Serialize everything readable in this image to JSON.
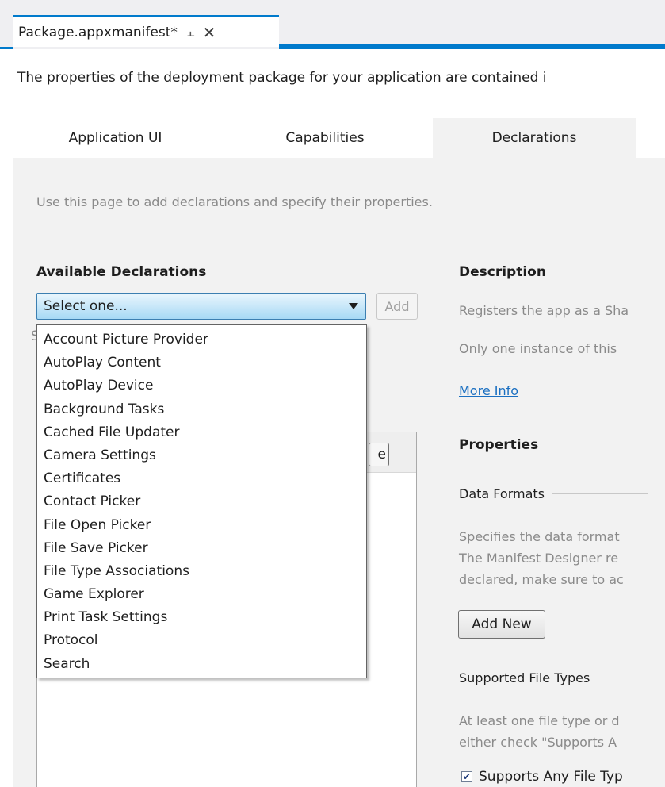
{
  "document_tab": {
    "title": "Package.appxmanifest*",
    "pin_glyph": "⌂",
    "close_glyph": "✕"
  },
  "intro": "The properties of the deployment package for your application are contained i",
  "section_tabs": [
    {
      "label": "Application UI",
      "active": false
    },
    {
      "label": "Capabilities",
      "active": false
    },
    {
      "label": "Declarations",
      "active": true
    }
  ],
  "page": {
    "hint": "Use this page to add declarations and specify their properties.",
    "available_heading": "Available Declarations",
    "select_value": "Select one...",
    "add_label": "Add",
    "stray_char": "S",
    "hidden_button_label": "e",
    "dropdown_options": [
      "Account Picture Provider",
      "AutoPlay Content",
      "AutoPlay Device",
      "Background Tasks",
      "Cached File Updater",
      "Camera Settings",
      "Certificates",
      "Contact Picker",
      "File Open Picker",
      "File Save Picker",
      "File Type Associations",
      "Game Explorer",
      "Print Task Settings",
      "Protocol",
      "Search"
    ]
  },
  "details": {
    "description_heading": "Description",
    "description_line1": "Registers the app as a Sha",
    "description_line2": "Only one instance of this",
    "more_info": "More Info",
    "properties_heading": "Properties",
    "data_formats_label": "Data Formats",
    "data_formats_text": [
      "Specifies the data format",
      "The Manifest Designer re",
      "declared, make sure to ac"
    ],
    "add_new_label": "Add New",
    "supported_file_types_label": "Supported File Types",
    "file_types_text": [
      "At least one file type or d",
      "either check \"Supports A"
    ],
    "supports_any_label": "Supports Any File Typ",
    "supports_any_checked": true
  },
  "colors": {
    "accent": "#007acc",
    "link": "#1a6fc1",
    "muted_text": "#8a8a8a"
  }
}
